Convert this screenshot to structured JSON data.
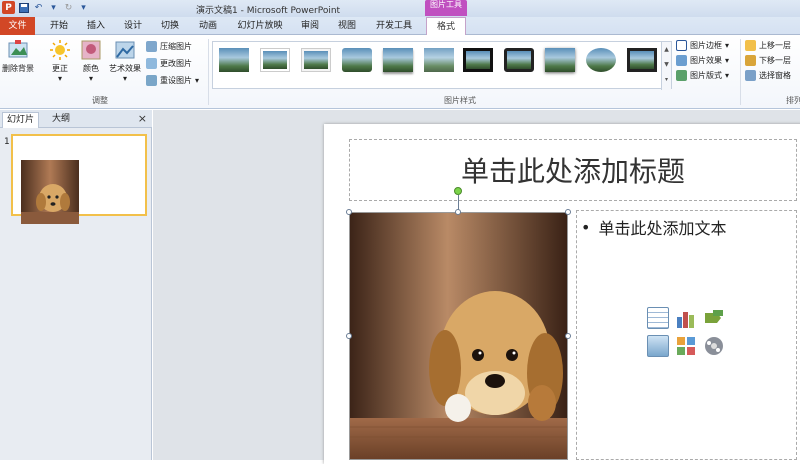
{
  "titlebar": {
    "title": "演示文稿1 - Microsoft PowerPoint",
    "context_tab": "图片工具",
    "logo": "P"
  },
  "tabs": [
    {
      "label": "文件"
    },
    {
      "label": "开始"
    },
    {
      "label": "插入"
    },
    {
      "label": "设计"
    },
    {
      "label": "切换"
    },
    {
      "label": "动画"
    },
    {
      "label": "幻灯片放映"
    },
    {
      "label": "审阅"
    },
    {
      "label": "视图"
    },
    {
      "label": "开发工具"
    },
    {
      "label": "格式"
    }
  ],
  "ribbon": {
    "adjust": {
      "remove_bg": "删除背景",
      "corrections": "更正",
      "color": "颜色",
      "artistic": "艺术效果",
      "compress": "压缩图片",
      "change": "更改图片",
      "reset": "重设图片",
      "group_label": "调整"
    },
    "styles": {
      "group_label": "图片样式",
      "border": "图片边框",
      "effects": "图片效果",
      "layout": "图片版式"
    },
    "arrange": {
      "bring_forward": "上移一层",
      "send_backward": "下移一层",
      "selection_pane": "选择窗格",
      "group_label": "排列"
    }
  },
  "left_pane": {
    "tab_slides": "幻灯片",
    "tab_outline": "大纲",
    "close": "×",
    "slide_number": "1"
  },
  "slide": {
    "title_placeholder": "单击此处添加标题",
    "bullet": "•",
    "text_placeholder": "单击此处添加文本"
  },
  "colors": {
    "accent_file": "#d24726",
    "context_tab": "#c050c0",
    "selection_thumb": "#f2c04a"
  }
}
